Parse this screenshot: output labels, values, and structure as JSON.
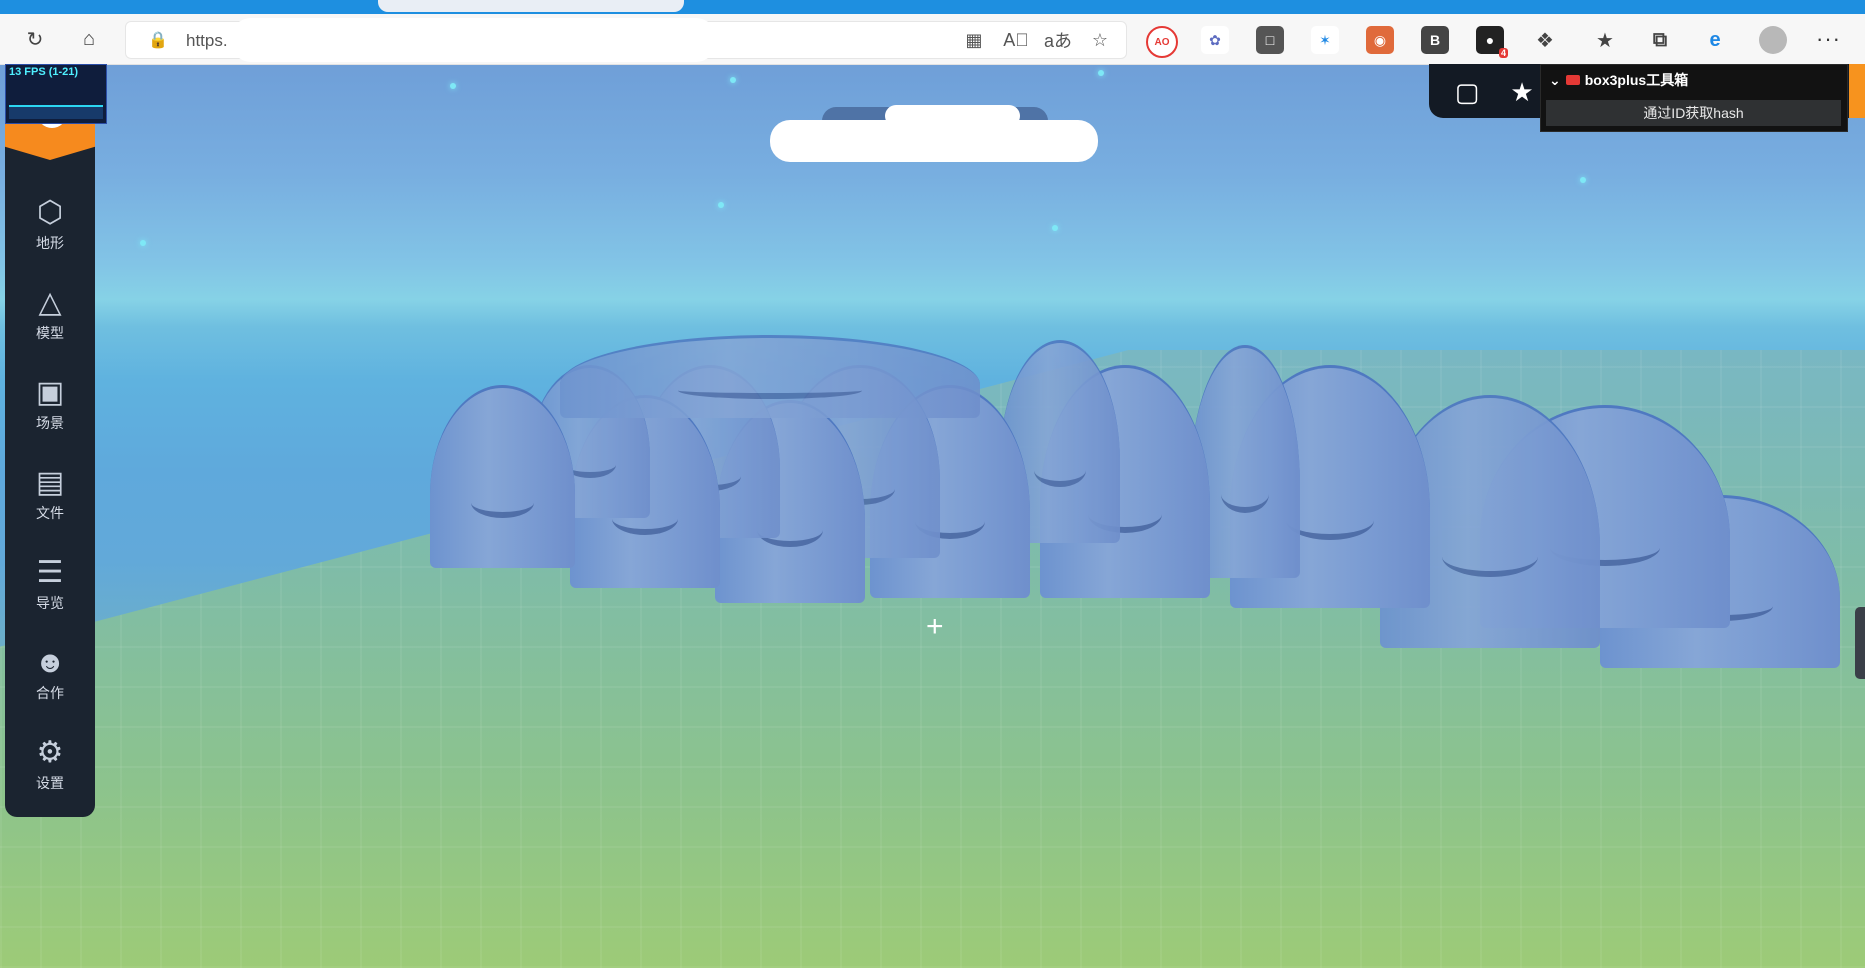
{
  "browser": {
    "address_text": "https.",
    "toolbar_icons": [
      "refresh-icon",
      "home-icon",
      "lock-icon"
    ],
    "address_tools": [
      "apps-icon",
      "read-aloud-icon",
      "translate-icon",
      "add-favorite-icon"
    ],
    "extensions": [
      {
        "name": "adblock-ext-icon",
        "color": "#e53935",
        "label": "AO"
      },
      {
        "name": "bird-ext-icon",
        "color": "#5c6bc0",
        "label": ""
      },
      {
        "name": "outlook-ext-icon",
        "color": "#555555",
        "label": ""
      },
      {
        "name": "colorful-ext-icon",
        "color": "#1e88e5",
        "label": ""
      },
      {
        "name": "tampermonkey-ext-icon",
        "color": "#e06a3b",
        "label": ""
      },
      {
        "name": "b-ext-icon",
        "color": "#444444",
        "label": "B"
      },
      {
        "name": "cat-ext-icon",
        "color": "#222222",
        "label": "",
        "badge": "4"
      },
      {
        "name": "puzzle-ext-icon",
        "color": "#555555",
        "label": ""
      }
    ],
    "right_icons": [
      "favorites-icon",
      "collections-icon",
      "edge-icon"
    ]
  },
  "fps": {
    "label": "13 FPS (1-21)"
  },
  "sidebar": {
    "items": [
      {
        "label": "地形",
        "icon": "cube-icon"
      },
      {
        "label": "模型",
        "icon": "tree-icon"
      },
      {
        "label": "场景",
        "icon": "image-icon"
      },
      {
        "label": "文件",
        "icon": "folder-icon"
      },
      {
        "label": "导览",
        "icon": "list-icon"
      },
      {
        "label": "合作",
        "icon": "users-icon"
      },
      {
        "label": "设置",
        "icon": "gear-icon"
      }
    ]
  },
  "top_right": {
    "icons": [
      "chat-icon",
      "bug-icon"
    ],
    "box3": {
      "title": "box3plus工具箱",
      "button": "通过ID获取hash"
    }
  }
}
